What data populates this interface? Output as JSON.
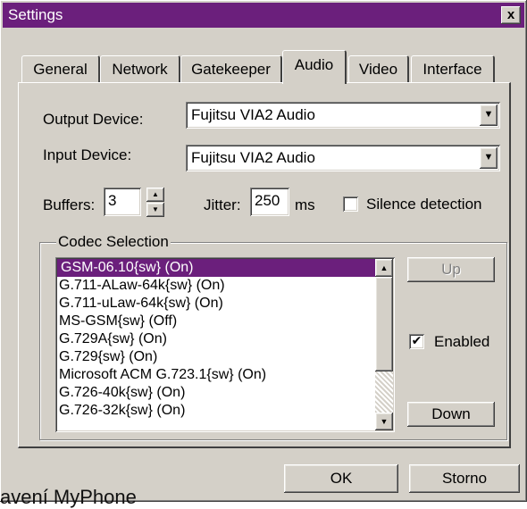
{
  "window": {
    "title": "Settings",
    "close_glyph": "x"
  },
  "tabs": [
    {
      "label": "General"
    },
    {
      "label": "Network"
    },
    {
      "label": "Gatekeeper"
    },
    {
      "label": "Audio",
      "active": true
    },
    {
      "label": "Video"
    },
    {
      "label": "Interface"
    }
  ],
  "audio": {
    "output_label": "Output Device:",
    "output_value": "Fujitsu VIA2 Audio",
    "input_label": "Input Device:",
    "input_value": "Fujitsu VIA2 Audio",
    "buffers_label": "Buffers:",
    "buffers_value": "3",
    "jitter_label": "Jitter:",
    "jitter_value": "250",
    "jitter_unit": "ms",
    "silence_label": "Silence detection",
    "silence_checked": false
  },
  "codec": {
    "group_title": "Codec Selection",
    "items": [
      "GSM-06.10{sw} (On)",
      "G.711-ALaw-64k{sw} (On)",
      "G.711-uLaw-64k{sw} (On)",
      "MS-GSM{sw} (Off)",
      "G.729A{sw} (On)",
      "G.729{sw} (On)",
      "Microsoft ACM G.723.1{sw} (On)",
      "G.726-40k{sw} (On)",
      "G.726-32k{sw} (On)"
    ],
    "selected_index": 0,
    "up_label": "Up",
    "down_label": "Down",
    "enabled_label": "Enabled",
    "enabled_checked": true
  },
  "footer": {
    "ok_label": "OK",
    "cancel_label": "Storno"
  },
  "caption": "avení MyPhone",
  "colors": {
    "titlebar": "#6b1f7c",
    "face": "#d4d0c8",
    "selection": "#6b1f7c"
  },
  "icons": {
    "dropdown": "dropdown-arrow-icon",
    "spin_up": "spin-up-icon",
    "spin_down": "spin-down-icon",
    "check": "check-icon"
  }
}
